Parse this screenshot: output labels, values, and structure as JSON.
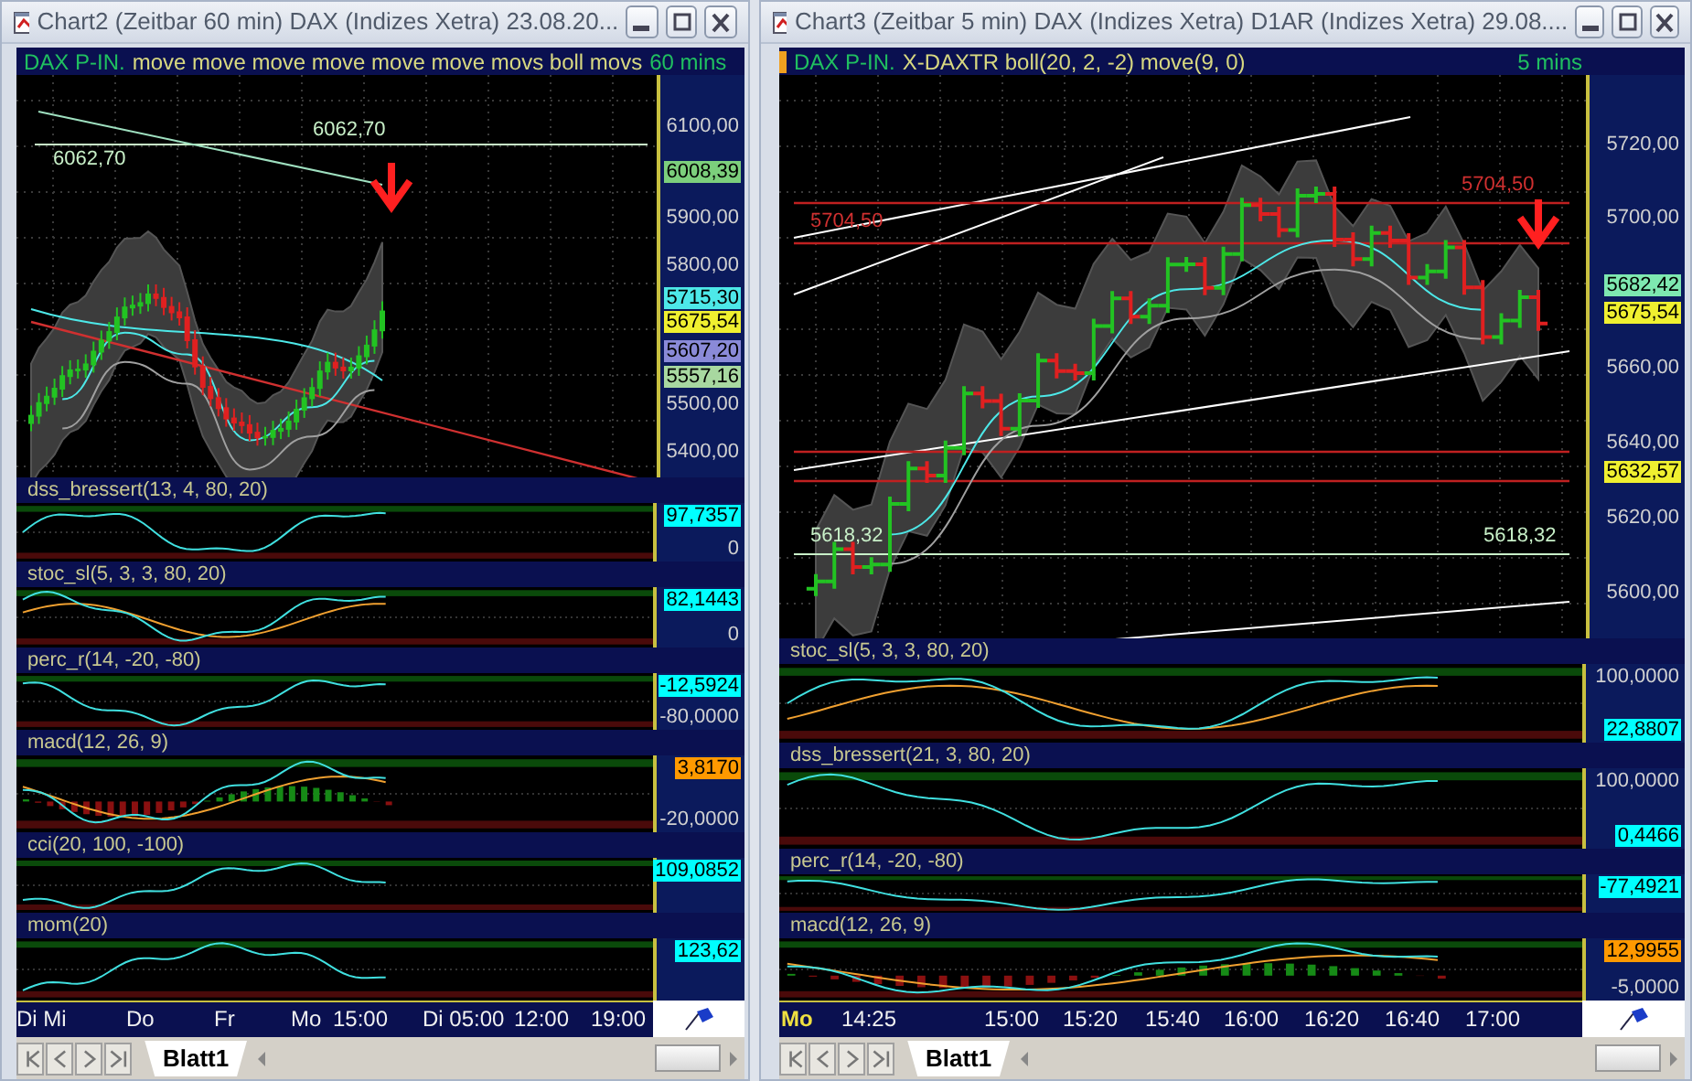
{
  "windows": [
    {
      "title": "Chart2 (Zeitbar 60 min)  DAX (Indizes Xetra) 23.08.20...",
      "header": {
        "symbol": "DAX P-IN.",
        "studies": "move move move move move move movs boll movs",
        "interval": "60 mins"
      },
      "chart_labels": [
        {
          "text": "6062,70",
          "color": "#c8f0c8"
        },
        {
          "text": "6062,70",
          "color": "#c8f0c8"
        }
      ],
      "price_axis": [
        {
          "text": "6100,00"
        },
        {
          "text": "6008,39",
          "color": "#7ccf7c"
        },
        {
          "text": "5900,00"
        },
        {
          "text": "5800,00"
        },
        {
          "text": "5715,30",
          "color": "#4de8e8"
        },
        {
          "text": "5675,54",
          "color": "#f0f030"
        },
        {
          "text": "5607,20",
          "color": "#8a8ad8"
        },
        {
          "text": "5557,16",
          "color": "#a8d8a0"
        },
        {
          "text": "5500,00"
        },
        {
          "text": "5400,00"
        }
      ],
      "indicators": [
        {
          "name": "dss_bressert(13, 4, 80, 20)",
          "kind": "single",
          "axis": [
            {
              "text": "97,7357",
              "color": "#00ffff"
            },
            {
              "text": "0"
            }
          ]
        },
        {
          "name": "stoc_sl(5, 3, 3, 80, 20)",
          "kind": "double",
          "axis": [
            {
              "text": "82,1443",
              "color": "#00ffff"
            },
            {
              "text": "0"
            }
          ]
        },
        {
          "name": "perc_r(14, -20, -80)",
          "kind": "single",
          "axis": [
            {
              "text": "-12,5924",
              "color": "#00ffff"
            },
            {
              "text": "-80,0000"
            }
          ]
        },
        {
          "name": "macd(12, 26, 9)",
          "kind": "double",
          "histogram": true,
          "axis": [
            {
              "text": "3,8170",
              "color": "#ff9900"
            },
            {
              "text": "-20,0000"
            }
          ]
        },
        {
          "name": "cci(20, 100, -100)",
          "kind": "single",
          "axis": [
            {
              "text": "109,0852",
              "color": "#00ffff"
            }
          ]
        },
        {
          "name": "mom(20)",
          "kind": "single",
          "axis": [
            {
              "text": "123,62",
              "color": "#00ffff"
            }
          ]
        }
      ],
      "time_axis": [
        {
          "text": "Di Mi",
          "kind": "label"
        },
        {
          "text": "Do",
          "kind": "label"
        },
        {
          "text": "Fr",
          "kind": "label"
        },
        {
          "text": "Mo",
          "kind": "label"
        },
        {
          "text": "15:00",
          "kind": "label"
        },
        {
          "text": "Di 05:00",
          "kind": "label"
        },
        {
          "text": "12:00",
          "kind": "label"
        },
        {
          "text": "19:00",
          "kind": "label"
        }
      ],
      "sheet_tab": {
        "label": "Blatt1",
        "selected": true
      }
    },
    {
      "title": "Chart3 (Zeitbar 5 min)  DAX (Indizes Xetra) D1AR (Indizes Xetra) 29.08....",
      "header": {
        "symbol": "DAX P-IN.",
        "studies": "X-DAXTR boll(20, 2, -2) move(9, 0)",
        "interval": "5 mins"
      },
      "chart_labels": [
        {
          "text": "5704,50",
          "color": "#d03030"
        },
        {
          "text": "5704,50",
          "color": "#d03030"
        },
        {
          "text": "5618,32",
          "color": "#c8f0c8"
        },
        {
          "text": "5618,32",
          "color": "#c8f0c8"
        }
      ],
      "price_axis": [
        {
          "text": "5720,00"
        },
        {
          "text": "5700,00"
        },
        {
          "text": "5682,42",
          "color": "#7ee8b0"
        },
        {
          "text": "5675,54",
          "color": "#f0f030"
        },
        {
          "text": "5660,00"
        },
        {
          "text": "5640,00"
        },
        {
          "text": "5632,57",
          "color": "#f0f030"
        },
        {
          "text": "5620,00"
        },
        {
          "text": "5600,00"
        }
      ],
      "indicators": [
        {
          "name": "stoc_sl(5, 3, 3, 80, 20)",
          "kind": "double",
          "axis": [
            {
              "text": "100,0000"
            },
            {
              "text": "22,8807",
              "color": "#00ffff"
            }
          ]
        },
        {
          "name": "dss_bressert(21, 3, 80, 20)",
          "kind": "single",
          "axis": [
            {
              "text": "100,0000"
            },
            {
              "text": "0,4466",
              "color": "#00ffff"
            }
          ]
        },
        {
          "name": "perc_r(14, -20, -80)",
          "kind": "single",
          "axis": [
            {
              "text": "-77,4921",
              "color": "#00ffff"
            }
          ]
        },
        {
          "name": "macd(12, 26, 9)",
          "kind": "double",
          "histogram": true,
          "axis": [
            {
              "text": "12,9955",
              "color": "#ff9900"
            },
            {
              "text": "-5,0000"
            }
          ]
        }
      ],
      "time_axis": [
        {
          "text": "Mo",
          "kind": "day"
        },
        {
          "text": "14:25",
          "kind": "time"
        },
        {
          "text": "15:00",
          "kind": "time"
        },
        {
          "text": "15:20",
          "kind": "time"
        },
        {
          "text": "15:40",
          "kind": "time"
        },
        {
          "text": "16:00",
          "kind": "time"
        },
        {
          "text": "16:20",
          "kind": "time"
        },
        {
          "text": "16:40",
          "kind": "time"
        },
        {
          "text": "17:00",
          "kind": "time"
        }
      ],
      "sheet_tab": {
        "label": "Blatt1",
        "selected": true
      }
    }
  ]
}
